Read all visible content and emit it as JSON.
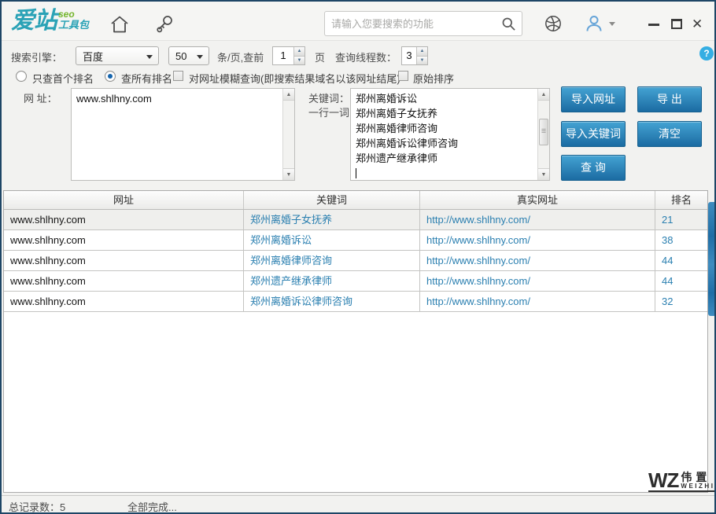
{
  "window": {
    "logo_main": "爱站",
    "logo_sup": "seo",
    "logo_sub": "工具包",
    "search_placeholder": "请输入您要搜索的功能"
  },
  "toolbar": {
    "engine_label": "搜索引擎：",
    "engine_value": "百度",
    "per_page_value": "50",
    "per_page_suffix": "条/页,查前",
    "page_value": "1",
    "page_suffix": "页",
    "threads_label": "查询线程数：",
    "threads_value": "3",
    "help_glyph": "?"
  },
  "options": {
    "radio_first_label": "只查首个排名",
    "radio_all_label": "查所有排名",
    "checkbox_fuzzy_label": "对网址模糊查询(即搜索结果域名以该网址结尾)",
    "checkbox_original_label": "原始排序"
  },
  "inputs": {
    "url_label": "网  址：",
    "url_value": "www.shlhny.com",
    "keyword_label": "关键词：",
    "keyword_sublabel": "一行一词",
    "keywords": [
      "郑州离婚诉讼",
      "郑州离婚子女抚养",
      "郑州离婚律师咨询",
      "郑州离婚诉讼律师咨询",
      "郑州遗产继承律师"
    ]
  },
  "buttons": {
    "import_url": "导入网址",
    "export": "导 出",
    "import_keywords": "导入关键词",
    "clear": "清空",
    "query": "查 询"
  },
  "table": {
    "headers": [
      "网址",
      "关键词",
      "真实网址",
      "排名"
    ],
    "rows": [
      {
        "url": "www.shlhny.com",
        "keyword": "郑州离婚子女抚养",
        "real_url": "http://www.shlhny.com/",
        "rank": "21"
      },
      {
        "url": "www.shlhny.com",
        "keyword": "郑州离婚诉讼",
        "real_url": "http://www.shlhny.com/",
        "rank": "38"
      },
      {
        "url": "www.shlhny.com",
        "keyword": "郑州离婚律师咨询",
        "real_url": "http://www.shlhny.com/",
        "rank": "44"
      },
      {
        "url": "www.shlhny.com",
        "keyword": "郑州遗产继承律师",
        "real_url": "http://www.shlhny.com/",
        "rank": "44"
      },
      {
        "url": "www.shlhny.com",
        "keyword": "郑州离婚诉讼律师咨询",
        "real_url": "http://www.shlhny.com/",
        "rank": "32"
      }
    ],
    "selected_row_index": 0
  },
  "statusbar": {
    "total": "总记录数：5",
    "status": "全部完成...",
    "watermark_main": "WZ",
    "watermark_cn": "伟置",
    "watermark_en": "WEIZHI"
  },
  "colors": {
    "accent_button_blue": "#1b6ba2",
    "link_blue": "#2a7fb0",
    "logo_teal": "#2aa2b6",
    "logo_green": "#74b52c",
    "help_blue": "#35aee3",
    "window_border": "#1e4666"
  }
}
